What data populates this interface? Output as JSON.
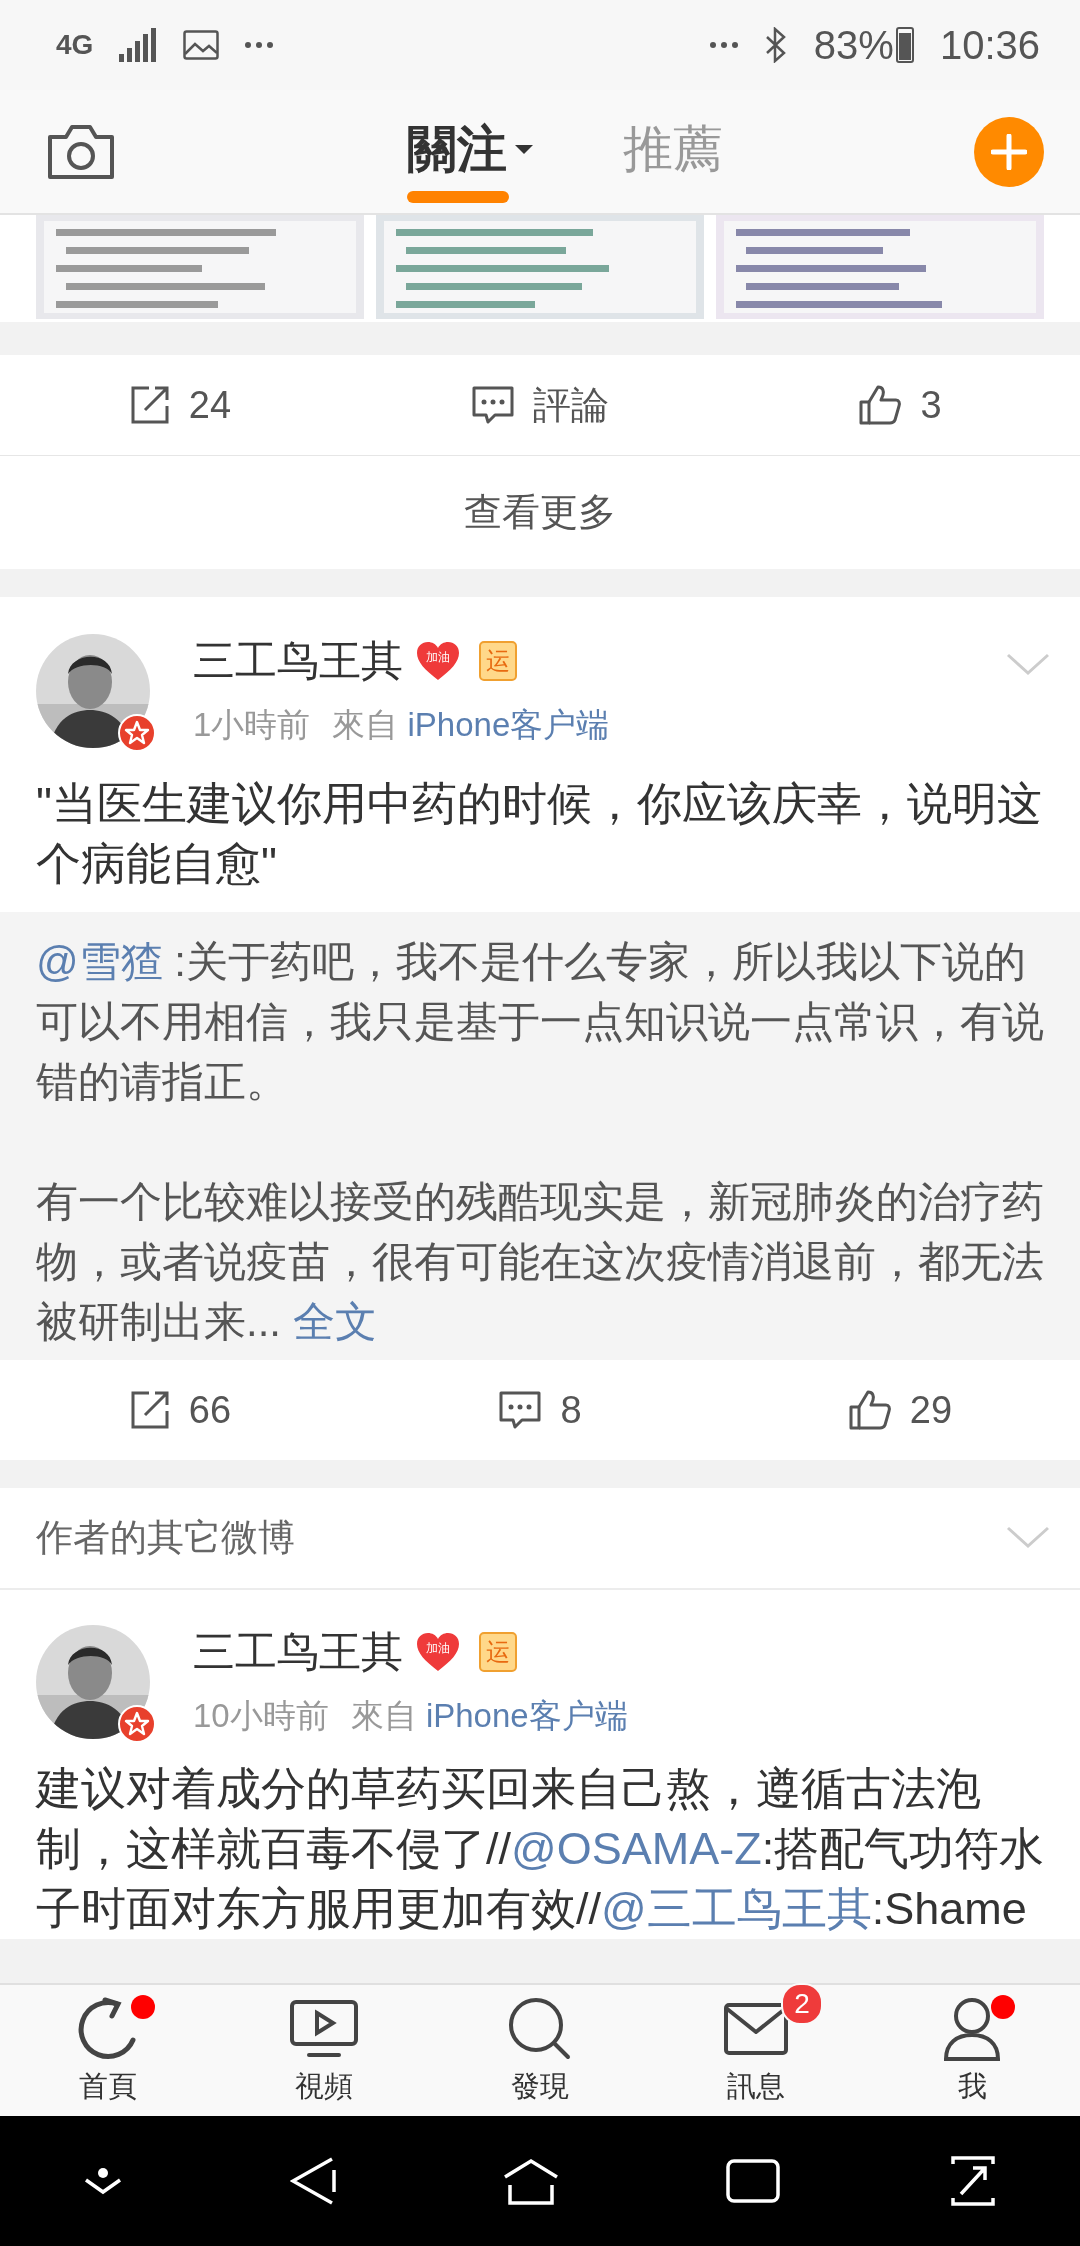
{
  "status_bar": {
    "network": "4G",
    "battery": "83%",
    "time": "10:36"
  },
  "header": {
    "tabs": [
      {
        "label": "關注",
        "selected": true,
        "dropdown": true
      },
      {
        "label": "推薦",
        "selected": false,
        "dropdown": false
      }
    ]
  },
  "top_post": {
    "actions": [
      {
        "kind": "repost",
        "label": "24"
      },
      {
        "kind": "comment",
        "label": "評論"
      },
      {
        "kind": "like",
        "label": "3"
      }
    ],
    "more": "查看更多"
  },
  "post": {
    "author": "三工鸟王其",
    "badges": [
      {
        "kind": "heart",
        "text": "加油"
      },
      {
        "kind": "tag",
        "text": "运"
      }
    ],
    "verified": true,
    "menu": true,
    "time": "1小時前",
    "source_prefix": "來自",
    "source": "iPhone客户端",
    "text": "\"当医生建议你用中药的时候，你应该庆幸，说明这个病能自愈\"",
    "repost": {
      "mention": "@雪猹",
      "paragraphs": [
        ":关于药吧，我不是什么专家，所以我以下说的可以不用相信，我只是基于一点知识说一点常识，有说错的请指正。",
        "有一个比较难以接受的残酷现实是，新冠肺炎的治疗药物，或者说疫苗，很有可能在这次疫情消退前，都无法被研制出来..."
      ],
      "more": "全文"
    },
    "actions": [
      {
        "kind": "repost",
        "label": "66"
      },
      {
        "kind": "comment",
        "label": "8"
      },
      {
        "kind": "like",
        "label": "29"
      }
    ]
  },
  "author_section": {
    "title": "作者的其它微博",
    "expanded": false
  },
  "post2": {
    "author": "三工鸟王其",
    "badges": [
      {
        "kind": "heart",
        "text": "加油"
      },
      {
        "kind": "tag",
        "text": "运"
      }
    ],
    "verified": true,
    "time": "10小時前",
    "source_prefix": "來自",
    "source": "iPhone客户端",
    "segments": [
      {
        "kind": "text",
        "text": "建议对着成分的草药买回来自己熬，遵循古法泡制，这样就百毒不侵了//"
      },
      {
        "kind": "mention",
        "text": "@OSAMA-Z"
      },
      {
        "kind": "text",
        "text": ":搭配气功符水子时面对东方服用更加有效//"
      },
      {
        "kind": "mention",
        "text": "@三工鸟王其"
      },
      {
        "kind": "text",
        "text": ":Shame"
      }
    ]
  },
  "tab_bar": [
    {
      "kind": "home",
      "label": "首頁",
      "dot": true
    },
    {
      "kind": "video",
      "label": "視頻",
      "dot": false
    },
    {
      "kind": "discover",
      "label": "發現",
      "dot": false
    },
    {
      "kind": "messages",
      "label": "訊息",
      "dot": false,
      "badge": "2"
    },
    {
      "kind": "profile",
      "label": "我",
      "dot": true
    }
  ]
}
